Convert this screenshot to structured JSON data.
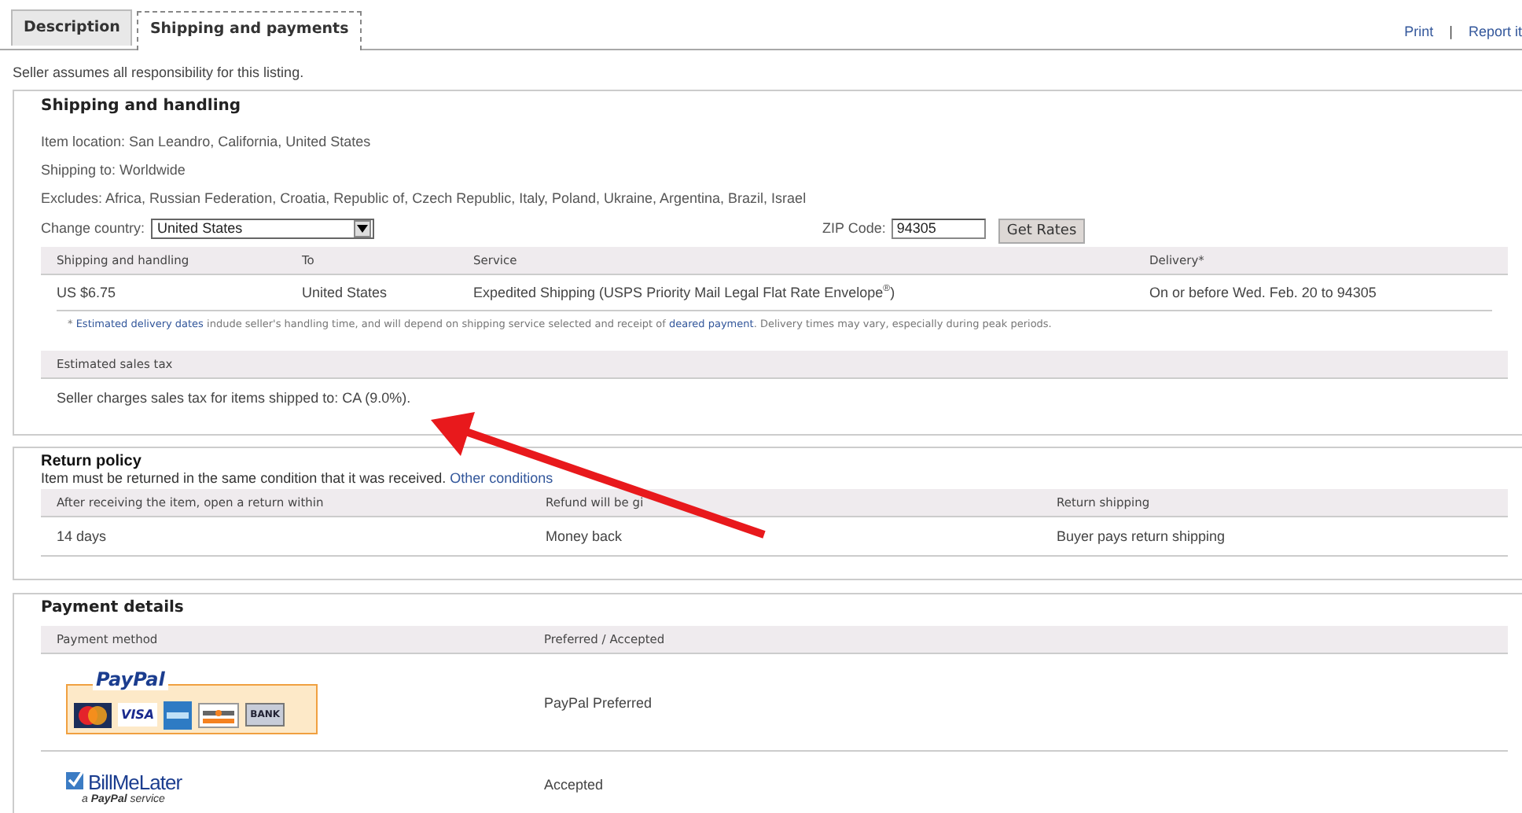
{
  "tabs": [
    {
      "label": "Description",
      "selected": false
    },
    {
      "label": "Shipping and payments",
      "selected": true
    }
  ],
  "top_links": {
    "items": [
      "Print",
      "Report it"
    ],
    "separator": "|"
  },
  "notice": "Seller assumes all responsibility for this listing.",
  "shipping": {
    "title": "Shipping and handling",
    "lines": [
      "Item location: San Leandro, California, United States",
      "Shipping to: Worldwide",
      "Excludes: Africa, Russian Federation, Croatia, Republic of, Czech Republic, Italy, Poland, Ukraine, Argentina, Brazil, Israel"
    ],
    "country": {
      "label": "Change country:",
      "value": "United States"
    },
    "zip": {
      "label": "ZIP Code:",
      "value": "94305"
    },
    "button": "Get Rates",
    "columns": [
      "Shipping and handling",
      "To",
      "Service",
      "Delivery*"
    ],
    "rows": [
      [
        "US $6.75",
        "United States",
        "Expedited Shipping (USPS Priority Mail Legal Flat Rate Envelope$^{®}$)",
        "On or before Wed. Feb. 20 to 94305"
      ]
    ],
    "note": [
      {
        "text": "* ",
        "link": false
      },
      {
        "text": "Estimated delivery dates",
        "link": true
      },
      {
        "text": " indude seller's handling time, and will depend on shipping service selected and receipt of ",
        "link": false
      },
      {
        "text": "deared payment",
        "link": true
      },
      {
        "text": ". Delivery times may vary, especially during peak periods.",
        "link": false
      }
    ],
    "tax_header": "Estimated sales tax",
    "tax_text": "Seller charges sales tax for items shipped to: CA (9.0%)."
  },
  "returns": {
    "title": "Return policy",
    "text": "Item must be returned in the same condition that it was received.",
    "link": "Other conditions",
    "columns": [
      "After receiving the item, open a return within",
      "Refund will be gi",
      "Return shipping"
    ],
    "row": [
      "14 days",
      "Money back",
      "Buyer pays return shipping"
    ]
  },
  "payment": {
    "title": "Payment details",
    "columns": [
      "Payment method",
      "Preferred / Accepted"
    ],
    "rows": [
      {
        "kind": "paypal",
        "logo_text": "PayPal",
        "cards": [
          "VISA",
          "BANK"
        ],
        "status": "PayPal Preferred"
      },
      {
        "kind": "billmelater",
        "logo_text": "BillMeLater",
        "logo_subtext": "a **PayPal** service",
        "status": "Accepted"
      }
    ]
  }
}
